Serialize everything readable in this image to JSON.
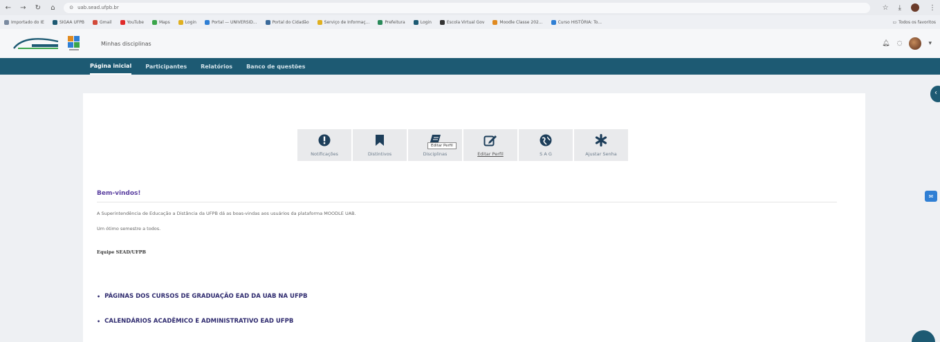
{
  "browser": {
    "url": "uab.sead.ufpb.br",
    "bookmarks": [
      {
        "label": "Importado do IE",
        "color": "#7a8aa0"
      },
      {
        "label": "SIGAA UFPB",
        "color": "#1d5a73"
      },
      {
        "label": "Gmail",
        "color": "#d24a3a"
      },
      {
        "label": "YouTube",
        "color": "#e02a2a"
      },
      {
        "label": "Maps",
        "color": "#3aa54a"
      },
      {
        "label": "Login",
        "color": "#e0b020"
      },
      {
        "label": "Portal — UNIVERSID...",
        "color": "#2f7fd4"
      },
      {
        "label": "Portal do Cidadão",
        "color": "#3a6a9a"
      },
      {
        "label": "Serviço de Informaç...",
        "color": "#e0b020"
      },
      {
        "label": "Prefeitura",
        "color": "#2a8a5a"
      },
      {
        "label": "Login",
        "color": "#1d5a73"
      },
      {
        "label": "Escola Virtual Gov",
        "color": "#333333"
      },
      {
        "label": "Moodle Classe 202...",
        "color": "#e08a20"
      },
      {
        "label": "Curso HISTÓRIA: To...",
        "color": "#2f7fd4"
      }
    ],
    "bookmarks_all": "Todos os favoritos"
  },
  "header": {
    "title": "Minhas disciplinas"
  },
  "nav": {
    "items": [
      "Página inicial",
      "Participantes",
      "Relatórios",
      "Banco de questões"
    ]
  },
  "quick_links": [
    {
      "label": "Notificações",
      "icon": "exclamation-icon"
    },
    {
      "label": "Distintivos",
      "icon": "bookmark-icon"
    },
    {
      "label": "Disciplinas",
      "icon": "book-icon"
    },
    {
      "label": "Editar Perfil",
      "icon": "edit-icon"
    },
    {
      "label": "S A G",
      "icon": "globe-icon"
    },
    {
      "label": "Ajustar Senha",
      "icon": "asterisk-icon"
    }
  ],
  "tooltip": "Editar Perfil",
  "content": {
    "welcome": "Bem-vindos!",
    "paragraph1": "A Superintendência de Educação a Distância da UFPB dá as boas-vindas aos usuários da plataforma MOODLE UAB.",
    "paragraph2": "Um ótimo semestre a todos.",
    "team": "Equipe SEAD/UFPB",
    "links": [
      "PÁGINAS DOS CURSOS DE GRADUAÇÃO EAD DA UAB NA UFPB",
      "CALENDÁRIOS ACADÊMICO E ADMINISTRATIVO EAD UFPB"
    ]
  },
  "colors": {
    "nav_bg": "#1d5a73",
    "welcome": "#5a3fa0",
    "link": "#2e2a6e"
  }
}
